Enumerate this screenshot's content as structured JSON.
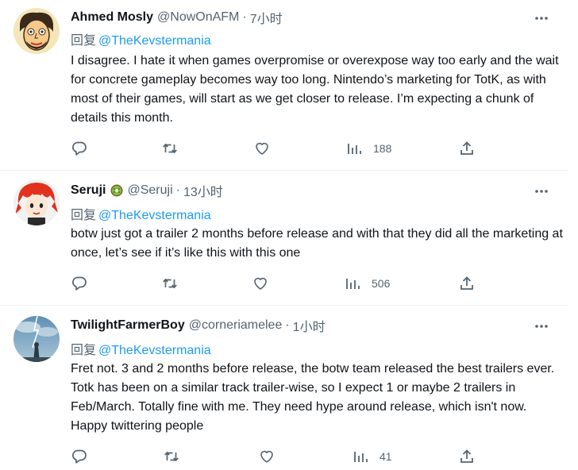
{
  "tweets": [
    {
      "name": "Ahmed Mosly",
      "handle": "@NowOnAFM",
      "dot": "·",
      "time": "7小时",
      "reply_prefix": "回复",
      "reply_to": "@TheKevstermania",
      "text": "I disagree. I hate it when games overpromise or overexpose way too early and the wait for concrete gameplay becomes way too long. Nintendo’s marketing for TotK, as with most of their games, will start as we get closer to release. I’m expecting a chunk of details this month.",
      "views": "188",
      "avatar_icon": "cartoon-portrait-avatar"
    },
    {
      "name": "Seruji",
      "handle": "@Seruji",
      "dot": "·",
      "time": "13小时",
      "reply_prefix": "回复",
      "reply_to": "@TheKevstermania",
      "text": "botw just got a trailer 2 months before release and with that they did all the marketing at once, let’s see if it’s like this with this one",
      "views": "506",
      "name_badge_icon": "kiwi-emoji-icon",
      "avatar_icon": "red-haired-character-avatar"
    },
    {
      "name": "TwilightFarmerBoy",
      "handle": "@corneriamelee",
      "dot": "·",
      "time": "1小时",
      "reply_prefix": "回复",
      "reply_to": "@TheKevstermania",
      "text": "Fret not. 3 and 2 months before release, the botw team released the best trailers ever. Totk has been on a similar track trailer-wise, so I expect 1 or maybe 2 trailers in Feb/March. Totally fine with me. They need hype around release, which isn't now. Happy twittering people",
      "views": "41",
      "avatar_icon": "stormy-sky-avatar"
    }
  ],
  "icons": {
    "more": "more-dots-icon",
    "reply": "reply-bubble-icon",
    "retweet": "retweet-arrows-icon",
    "like": "heart-icon",
    "views": "views-bar-chart-icon",
    "share": "share-upload-icon"
  },
  "colors": {
    "text": "#0f1419",
    "secondary": "#536471",
    "link": "#1d9bf0",
    "divider": "#eff3f4"
  }
}
